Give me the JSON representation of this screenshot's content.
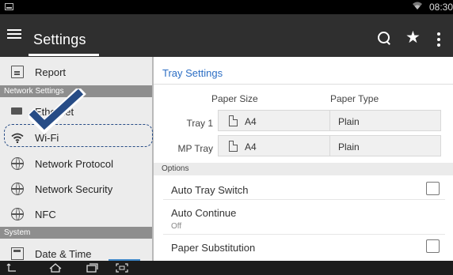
{
  "status_bar": {
    "time": "08:30",
    "icons": [
      "screen-icon",
      "wifi-signal-icon"
    ]
  },
  "app_bar": {
    "title": "Settings",
    "icons": [
      "menu-icon",
      "search-icon",
      "star-icon",
      "more-vert-icon"
    ]
  },
  "sidebar": {
    "items": [
      {
        "label": "Report",
        "icon": "report-document-icon"
      },
      {
        "header": "Network Settings"
      },
      {
        "label": "Ethernet",
        "icon": "ethernet-icon"
      },
      {
        "label": "Wi-Fi",
        "icon": "wifi-icon"
      },
      {
        "label": "Network Protocol",
        "icon": "globe-icon"
      },
      {
        "label": "Network Security",
        "icon": "globe-icon"
      },
      {
        "label": "NFC",
        "icon": "globe-icon"
      },
      {
        "header": "System"
      },
      {
        "label": "Date & Time",
        "icon": "date-time-icon"
      }
    ]
  },
  "annotations": {
    "check_mark": "check-mark-icon",
    "highlight": "Wi-Fi",
    "highlight_color": "#274c86"
  },
  "content": {
    "heading": "Tray Settings",
    "columns": {
      "size": "Paper Size",
      "type": "Paper Type"
    },
    "trays": [
      {
        "label": "Tray 1",
        "size": "A4",
        "type": "Plain"
      },
      {
        "label": "MP Tray",
        "size": "A4",
        "type": "Plain"
      }
    ],
    "options_header": "Options",
    "options": [
      {
        "label": "Auto Tray Switch",
        "checked": false
      },
      {
        "label": "Auto Continue",
        "value": "Off"
      },
      {
        "label": "Paper Substitution",
        "checked": false
      }
    ]
  },
  "nav_bar": {
    "icons": [
      "back-icon",
      "home-icon",
      "recent-apps-icon",
      "screenshot-icon"
    ]
  },
  "colors": {
    "app_bar": "#2f2f2f",
    "accent": "#2c6ec4",
    "sidebar_bg": "#ececec",
    "sidebar_header": "#8e8e8e"
  }
}
